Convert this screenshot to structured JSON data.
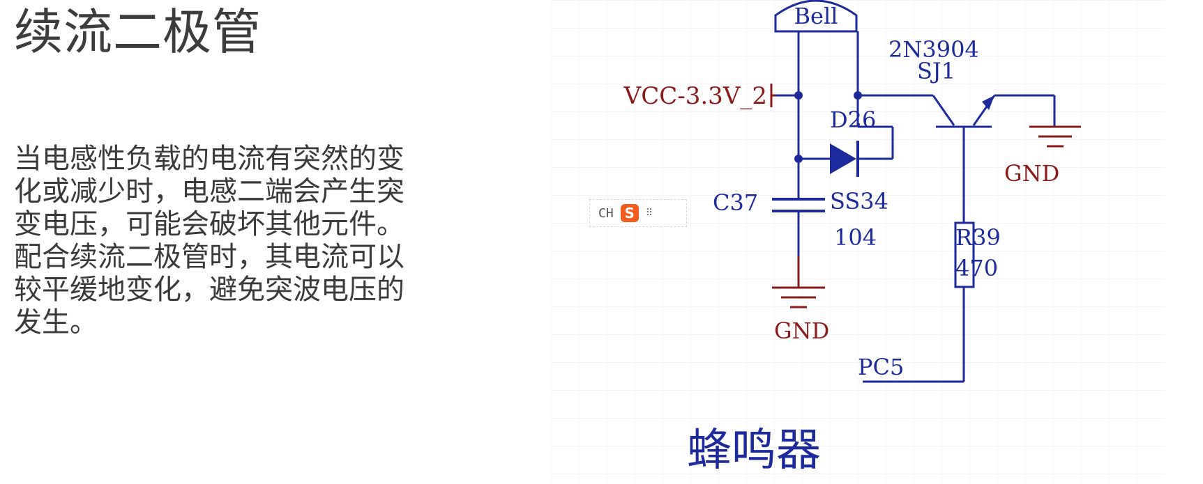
{
  "slide": {
    "title": "续流二极管",
    "body_lines": [
      "当电感性负载的电流有突然的变",
      "化或减少时，电感二端会产生突",
      "变电压，可能会破坏其他元件。",
      "配合续流二极管时，其电流可以",
      "较平缓地变化，避免突波电压的",
      "发生。"
    ]
  },
  "schematic": {
    "labels": {
      "bell": "Bell",
      "transistor_part": "2N3904",
      "transistor_ref": "SJ1",
      "vcc": "VCC-3.3V_2",
      "diode_ref": "D26",
      "diode_part": "SS34",
      "cap_ref": "C37",
      "cap_value": "104",
      "resistor_ref": "R39",
      "resistor_value": "470",
      "gnd_left": "GND",
      "gnd_right": "GND",
      "pc5": "PC5",
      "caption": "蜂鸣器"
    },
    "colors": {
      "wire": "#1c2a9c",
      "power_net": "#8b1a1a",
      "grid": "#ececec"
    }
  },
  "ime_toolbar": {
    "mode": "CH",
    "logo": "S",
    "more": "⠿"
  }
}
